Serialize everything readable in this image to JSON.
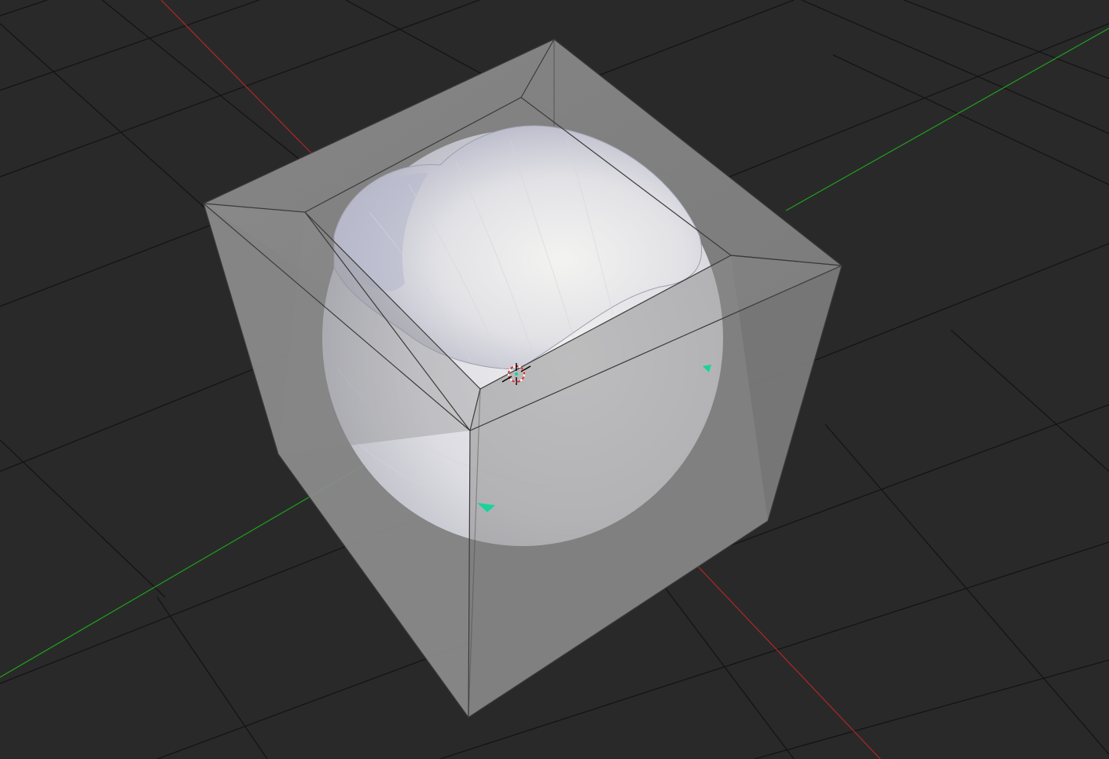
{
  "viewport": {
    "name": "3D Viewport",
    "background_color": "#292929",
    "grid_color": "#121212",
    "x_axis_color": "#b02727",
    "y_axis_color": "#1f9f1f",
    "cube_face_color": "#9a9a9a",
    "cube_edge_color": "#3a3a3a",
    "bowl_color": "#e6e6ea",
    "object_origin_color": "#19d39a",
    "cursor_icon": "3d-cursor-icon",
    "objects": [
      {
        "name": "cube",
        "display": "wire-transparent"
      },
      {
        "name": "bowl",
        "display": "solid"
      }
    ]
  }
}
